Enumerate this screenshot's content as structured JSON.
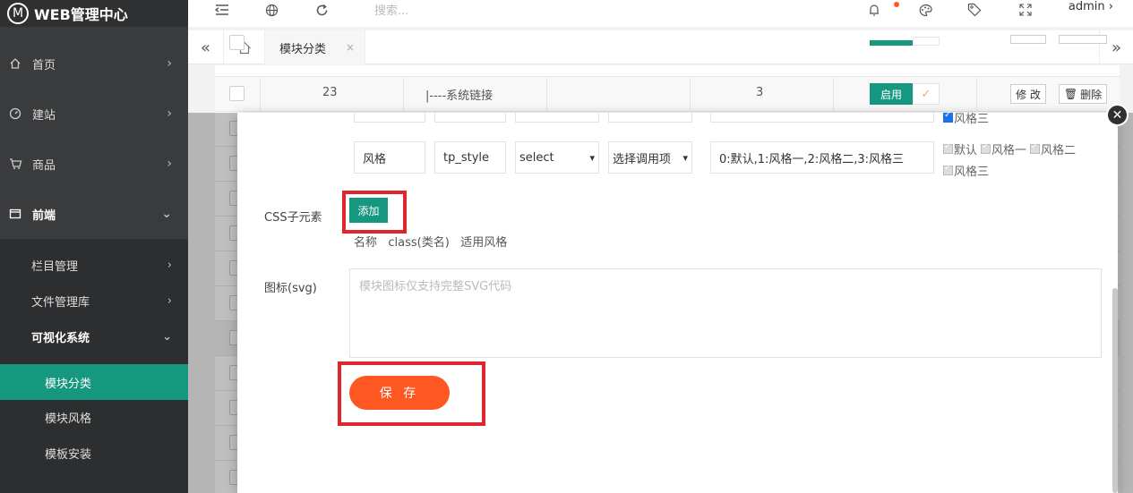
{
  "app": {
    "logo_letter": "M",
    "title": "WEB管理中心"
  },
  "sidebar": {
    "items": [
      {
        "label": "首页",
        "icon": "home-icon"
      },
      {
        "label": "建站",
        "icon": "dashboard-icon"
      },
      {
        "label": "商品",
        "icon": "cart-icon"
      },
      {
        "label": "前端",
        "icon": "window-icon"
      }
    ],
    "sub": [
      {
        "label": "栏目管理"
      },
      {
        "label": "文件管理库"
      },
      {
        "label": "可视化系统"
      }
    ],
    "sub2": [
      {
        "label": "模块分类",
        "active": true
      },
      {
        "label": "模块风格"
      },
      {
        "label": "模板安装"
      }
    ]
  },
  "topbar": {
    "search_placeholder": "搜索...",
    "user": "admin"
  },
  "tabs": {
    "active": "模块分类",
    "close": "×"
  },
  "table": {
    "row": {
      "id": "23",
      "name": "|----系统链接",
      "count": "3",
      "enable": "启用",
      "edit": "修 改",
      "delete": "删除"
    }
  },
  "modal": {
    "field_row": {
      "name": "风格",
      "key": "tp_style",
      "type": "select",
      "call": "选择调用项",
      "options": "0:默认,1:风格一,2:风格二,3:风格三"
    },
    "checkbox_top": "风格三",
    "checkboxes": [
      "默认",
      "风格一",
      "风格二"
    ],
    "checkbox_bottom": "风格三",
    "css_label": "CSS子元素",
    "add_button": "添加",
    "hint": "名称   class(类名)   适用风格",
    "icon_label": "图标(svg)",
    "icon_placeholder": "模块图标仅支持完整SVG代码",
    "save": "保 存",
    "close": "✕"
  },
  "colors": {
    "accent": "#16977f",
    "save": "#ff5722",
    "highlight": "#e0262c",
    "sidebar": "#3a3b3d"
  }
}
